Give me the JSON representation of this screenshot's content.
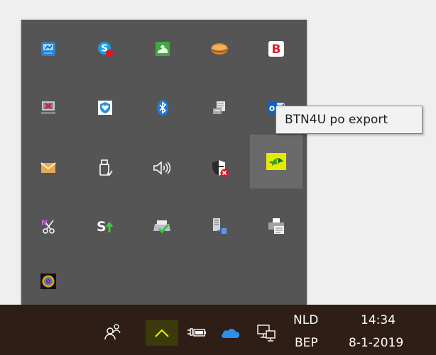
{
  "tray_overflow": {
    "icons": [
      {
        "name": "network-monitor-icon"
      },
      {
        "name": "skype-icon"
      },
      {
        "name": "green-cloud-icon"
      },
      {
        "name": "orange-sphere-icon"
      },
      {
        "name": "b-app-icon",
        "glyph": "B"
      },
      {
        "name": "network-disconnected-icon"
      },
      {
        "name": "shield-heart-icon"
      },
      {
        "name": "bluetooth-icon"
      },
      {
        "name": "print-scroll-icon"
      },
      {
        "name": "outlook-icon",
        "glyph": "o"
      },
      {
        "name": "mail-icon"
      },
      {
        "name": "usb-device-icon"
      },
      {
        "name": "speaker-icon"
      },
      {
        "name": "security-warning-icon"
      },
      {
        "name": "btn4u-export-icon"
      },
      {
        "name": "nx-scissors-icon",
        "glyph": "N"
      },
      {
        "name": "s-upload-icon",
        "glyph": "S"
      },
      {
        "name": "printer-check-icon"
      },
      {
        "name": "server-transfer-icon"
      },
      {
        "name": "printer-doc-icon"
      },
      {
        "name": "color-ring-icon"
      }
    ]
  },
  "tooltip": {
    "text": "BTN4U po export"
  },
  "taskbar": {
    "language_top": "NLD",
    "language_bottom": "BEP",
    "time": "14:34",
    "date": "8-1-2019"
  },
  "colors": {
    "flyout_bg": "#555555",
    "taskbar_bg": "#2e1e16",
    "highlight_yellow": "#e8e800",
    "onedrive_blue": "#2d8fe8"
  }
}
